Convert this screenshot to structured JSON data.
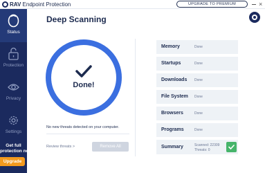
{
  "app": {
    "brand": "RAV",
    "product": "Endpoint Protection",
    "upgrade_label": "UPGRADE TO PREMIUM",
    "close_glyph": "×"
  },
  "sidebar": {
    "items": [
      {
        "label": "Status",
        "icon": "status-icon"
      },
      {
        "label": "Protection",
        "icon": "lock-icon"
      },
      {
        "label": "Privacy",
        "icon": "eye-icon"
      },
      {
        "label": "Settings",
        "icon": "gear-icon"
      }
    ],
    "promo_line1": "Get full",
    "promo_line2": "protection now",
    "promo_button": "Upgrade"
  },
  "main": {
    "title": "Deep Scanning",
    "result_label": "Done!",
    "threats_note": "No new threats detected on your computer.",
    "review_label": "Review threats >",
    "remove_label": "Remove All"
  },
  "scan": {
    "rows": [
      {
        "name": "Memory",
        "status": "Done"
      },
      {
        "name": "Startups",
        "status": "Done"
      },
      {
        "name": "Downloads",
        "status": "Done"
      },
      {
        "name": "File System",
        "status": "Done"
      },
      {
        "name": "Browsers",
        "status": "Done"
      },
      {
        "name": "Programs",
        "status": "Done"
      }
    ],
    "summary": {
      "label": "Summary",
      "scanned": "Scanned: 22309",
      "threats": "Threats: 0"
    }
  },
  "colors": {
    "sidebar": "#1b2a5e",
    "ring": "#3b6fe0",
    "accent_orange": "#f39a1e",
    "success_green": "#46b46a"
  }
}
